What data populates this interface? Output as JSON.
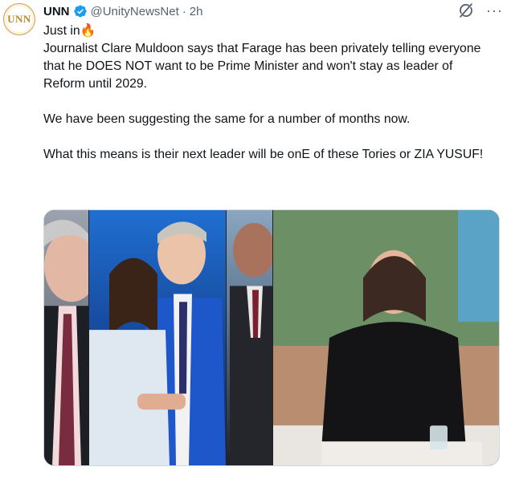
{
  "account": {
    "avatar_text": "UNN",
    "name": "UNN",
    "handle": "@UnityNewsNet",
    "separator": "·",
    "time": "2h",
    "verified_icon": "verified-badge-icon",
    "colors": {
      "verified": "#1d9bf0",
      "avatar_ring": "#c9a04a"
    }
  },
  "actions": {
    "grok_icon": "grok-icon",
    "more_label": "···"
  },
  "tweet": {
    "lead": "Just in",
    "lead_emoji": "🔥",
    "body": "Journalist Clare Muldoon says that Farage has been privately telling everyone that he DOES NOT want to be Prime Minister and won't stay as leader of Reform until 2029.\n\nWe have been suggesting the same for a number of months now.\n\nWhat this means is their next leader will be onE of these Tories or ZIA YUSUF!"
  },
  "media": {
    "panels": [
      "photo-panel-1",
      "photo-panel-2",
      "photo-panel-3",
      "photo-panel-4"
    ]
  }
}
